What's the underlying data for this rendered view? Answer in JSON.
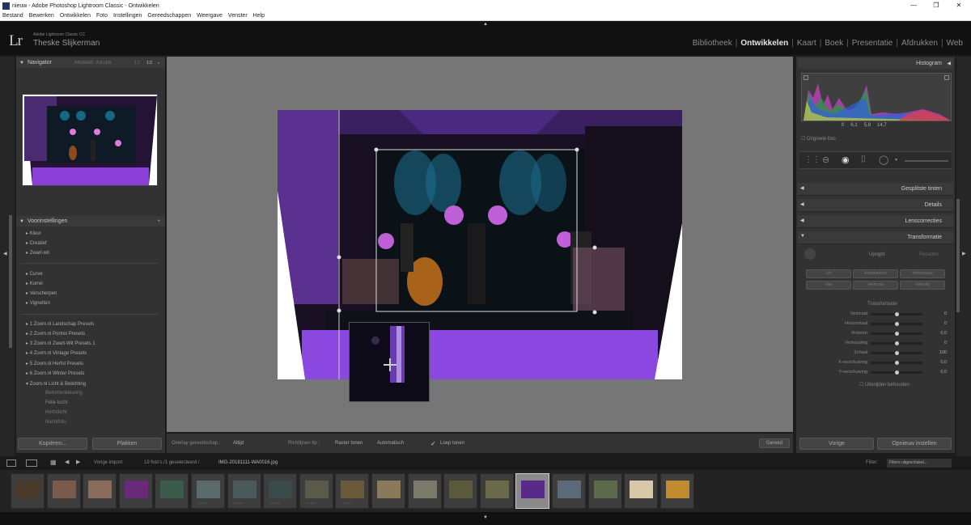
{
  "window": {
    "title": "nieuw - Adobe Photoshop Lightroom Classic - Ontwikkelen",
    "controls": [
      "—",
      "❒",
      "✕"
    ]
  },
  "menu": [
    "Bestand",
    "Bewerken",
    "Ontwikkelen",
    "Foto",
    "Instellingen",
    "Gereedschappen",
    "Weergave",
    "Venster",
    "Help"
  ],
  "identity": {
    "logo": "Lr",
    "product": "Adobe Lightroom Classic CC",
    "user": "Theske Slijkerman"
  },
  "modules": [
    "Bibliotheek",
    "Ontwikkelen",
    "Kaart",
    "Boek",
    "Presentatie",
    "Afdrukken",
    "Web"
  ],
  "active_module": "Ontwikkelen",
  "navigator": {
    "title": "Navigator",
    "zoom_options": [
      "PASSEND",
      "VULLEN",
      "1:1",
      "1:2"
    ]
  },
  "presets": {
    "title": "Voorinstellingen",
    "groups_a": [
      "Kleur",
      "Creatief",
      "Zwart-wit"
    ],
    "groups_b": [
      "Curve",
      "Korrel",
      "Verscherpen",
      "Vignetten"
    ],
    "groups_c": [
      "1 Zoom.nl Landschap Presets",
      "2 Zoom.nl Portret Presets",
      "3 Zoom.nl Zwart-Wit Presets 1",
      "4 Zoom.nl Vintage Presets",
      "5 Zoom.nl Herfst Presets",
      "6 Zoom.nl Winter Presets",
      "Zoom.nl Licht & Belichting"
    ],
    "sub_items": [
      "Belichtenkleuring",
      "Felle lucht",
      "Herfstlicht",
      "Nachtfoto"
    ]
  },
  "left_buttons": {
    "copy": "Kopiëren...",
    "paste": "Plakken"
  },
  "histogram": {
    "title": "Histogram",
    "readout": [
      "f/",
      "6,1",
      "5,8",
      "14,7"
    ],
    "original_label": "Originele foto"
  },
  "right_sections": [
    "Gesplitste tinten",
    "Details",
    "Lenscorrecties",
    "Transformatie"
  ],
  "transform": {
    "upright_label": "Upright",
    "reset_label": "Resetten",
    "upright_buttons": [
      "Uit",
      "Automatisch",
      "Horizontaal",
      "Vlak",
      "Verticaal",
      "Volledig"
    ],
    "heading": "Transformatie",
    "sliders": [
      {
        "label": "Verticaal",
        "value": "0",
        "pos": 0.5
      },
      {
        "label": "Horizontaal",
        "value": "0",
        "pos": 0.5
      },
      {
        "label": "Roteren",
        "value": "0,0",
        "pos": 0.5
      },
      {
        "label": "Verhouding",
        "value": "0",
        "pos": 0.5
      },
      {
        "label": "Schaal",
        "value": "100",
        "pos": 0.5
      },
      {
        "label": "X-verschuiving",
        "value": "0,0",
        "pos": 0.5
      },
      {
        "label": "Y-verschuiving",
        "value": "0,0",
        "pos": 0.5
      }
    ],
    "checkbox": "Uitsnijden behouden"
  },
  "right_buttons": {
    "previous": "Vorige",
    "reset": "Opnieuw instellen"
  },
  "toolbar": {
    "overlay_label": "Overlay gereedschap :",
    "overlay_value": "Altijd",
    "guides_label": "Richtlijnen tip :",
    "guides_value": "Raster tonen",
    "auto_label": "Automatisch",
    "loupe_label": "Loep tonen",
    "done": "Gereed"
  },
  "filmbar": {
    "source": "Vorige import",
    "info": "19 foto's /1 geselecteerd /",
    "filename": "IMG-20181111-WA0016.jpg",
    "filter_label": "Filter:",
    "filter_value": "Filters uitgeschakel..."
  },
  "thumbnails": [
    {
      "color": "#4a3a2a",
      "stars": ""
    },
    {
      "color": "#7a5a4a",
      "stars": ""
    },
    {
      "color": "#8a6a5a",
      "stars": ""
    },
    {
      "color": "#6a2a7a",
      "stars": ""
    },
    {
      "color": "#3a5a4a",
      "stars": ""
    },
    {
      "color": "#5a6a6a",
      "stars": "•••••"
    },
    {
      "color": "#4a5a5a",
      "stars": "•••••"
    },
    {
      "color": "#3a4a4a",
      "stars": "•••••"
    },
    {
      "color": "#5a5a4a",
      "stars": "•••••"
    },
    {
      "color": "#6a5a3a",
      "stars": "•••••"
    },
    {
      "color": "#8a7a5a",
      "stars": ""
    },
    {
      "color": "#7a7a6a",
      "stars": ""
    },
    {
      "color": "#5a5a3a",
      "stars": ""
    },
    {
      "color": "#6a6a4a",
      "stars": ""
    },
    {
      "color": "#5a2a8a",
      "stars": "",
      "selected": true
    },
    {
      "color": "#5a6a7a",
      "stars": ""
    },
    {
      "color": "#5a6a4a",
      "stars": ""
    },
    {
      "color": "#d8c8a8",
      "stars": ""
    },
    {
      "color": "#c08a30",
      "stars": ""
    }
  ]
}
